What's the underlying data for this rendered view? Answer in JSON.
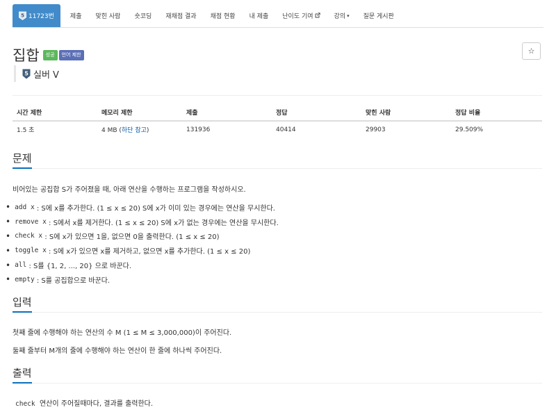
{
  "nav": {
    "problem_number": "11723번",
    "tier_badge_text": "5",
    "tabs": [
      "제출",
      "맞힌 사람",
      "숏코딩",
      "재채점 결과",
      "채점 현황",
      "내 제출"
    ],
    "contribute": "난이도 기여",
    "lecture": "강의",
    "board": "질문 게시판"
  },
  "problem": {
    "title": "집합",
    "label_success": "성공",
    "label_lang": "언어 제한",
    "tier_number": "5",
    "tier_text": "실버 V",
    "star": "☆"
  },
  "info": {
    "headers": [
      "시간 제한",
      "메모리 제한",
      "제출",
      "정답",
      "맞힌 사람",
      "정답 비율"
    ],
    "time_limit": "1.5 초",
    "memory_value": "4 MB (",
    "memory_link": "하단 참고",
    "memory_close": ")",
    "submissions": "131936",
    "accepted": "40414",
    "solvers": "29903",
    "ratio": "29.509%"
  },
  "sections": {
    "problem_heading": "문제",
    "problem_intro": "비어있는 공집합 S가 주어졌을 때, 아래 연산을 수행하는 프로그램을 작성하시오.",
    "ops": [
      {
        "cmd": "add x",
        "desc": ": S에 x를 추가한다. (1 ≤ x ≤ 20) S에 x가 이미 있는 경우에는 연산을 무시한다."
      },
      {
        "cmd": "remove x",
        "desc": ": S에서 x를 제거한다. (1 ≤ x ≤ 20) S에 x가 없는 경우에는 연산을 무시한다."
      },
      {
        "cmd": "check x",
        "desc": ": S에 x가 있으면 1을, 없으면 0을 출력한다. (1 ≤ x ≤ 20)"
      },
      {
        "cmd": "toggle x",
        "desc": ": S에 x가 있으면 x를 제거하고, 없으면 x를 추가한다. (1 ≤ x ≤ 20)"
      },
      {
        "cmd": "all",
        "desc": ": S를 {1, 2, ..., 20} 으로 바꾼다."
      },
      {
        "cmd": "empty",
        "desc": ": S를 공집합으로 바꾼다."
      }
    ],
    "input_heading": "입력",
    "input_line1": "첫째 줄에 수행해야 하는 연산의 수 M (1 ≤ M ≤ 3,000,000)이 주어진다.",
    "input_line2": "둘째 줄부터 M개의 줄에 수행해야 하는 연산이 한 줄에 하나씩 주어진다.",
    "output_heading": "출력",
    "output_cmd": "check",
    "output_text": "연산이 주어질때마다, 결과를 출력한다."
  },
  "colors": {
    "primary": "#428bca",
    "success": "#5cb85c",
    "lang_label": "#5b6fb6",
    "silver_tier": "#435f7a",
    "link": "#0b5cad",
    "section_underline": "#0b6fbc"
  }
}
